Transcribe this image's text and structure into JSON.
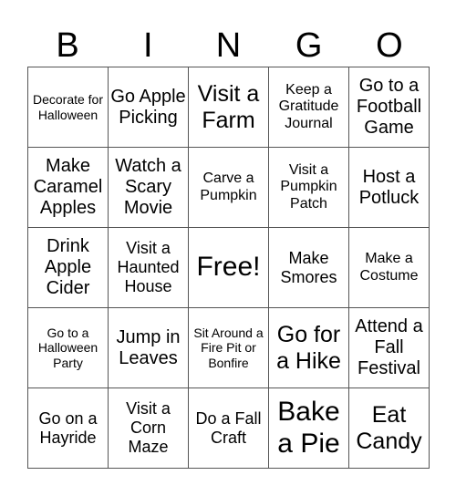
{
  "header": [
    "B",
    "I",
    "N",
    "G",
    "O"
  ],
  "cells": [
    "Decorate for Halloween",
    "Go Apple Picking",
    "Visit a Farm",
    "Keep a Gratitude Journal",
    "Go to a Football Game",
    "Make Caramel Apples",
    "Watch a Scary Movie",
    "Carve a Pumpkin",
    "Visit a Pumpkin Patch",
    "Host a Potluck",
    "Drink Apple Cider",
    "Visit a Haunted House",
    "Free!",
    "Make Smores",
    "Make a Costume",
    "Go to a Halloween Party",
    "Jump in Leaves",
    "Sit Around a Fire Pit or Bonfire",
    "Go for a Hike",
    "Attend a Fall Festival",
    "Go on a Hayride",
    "Visit a Corn Maze",
    "Do a Fall Craft",
    "Bake a Pie",
    "Eat Candy"
  ]
}
